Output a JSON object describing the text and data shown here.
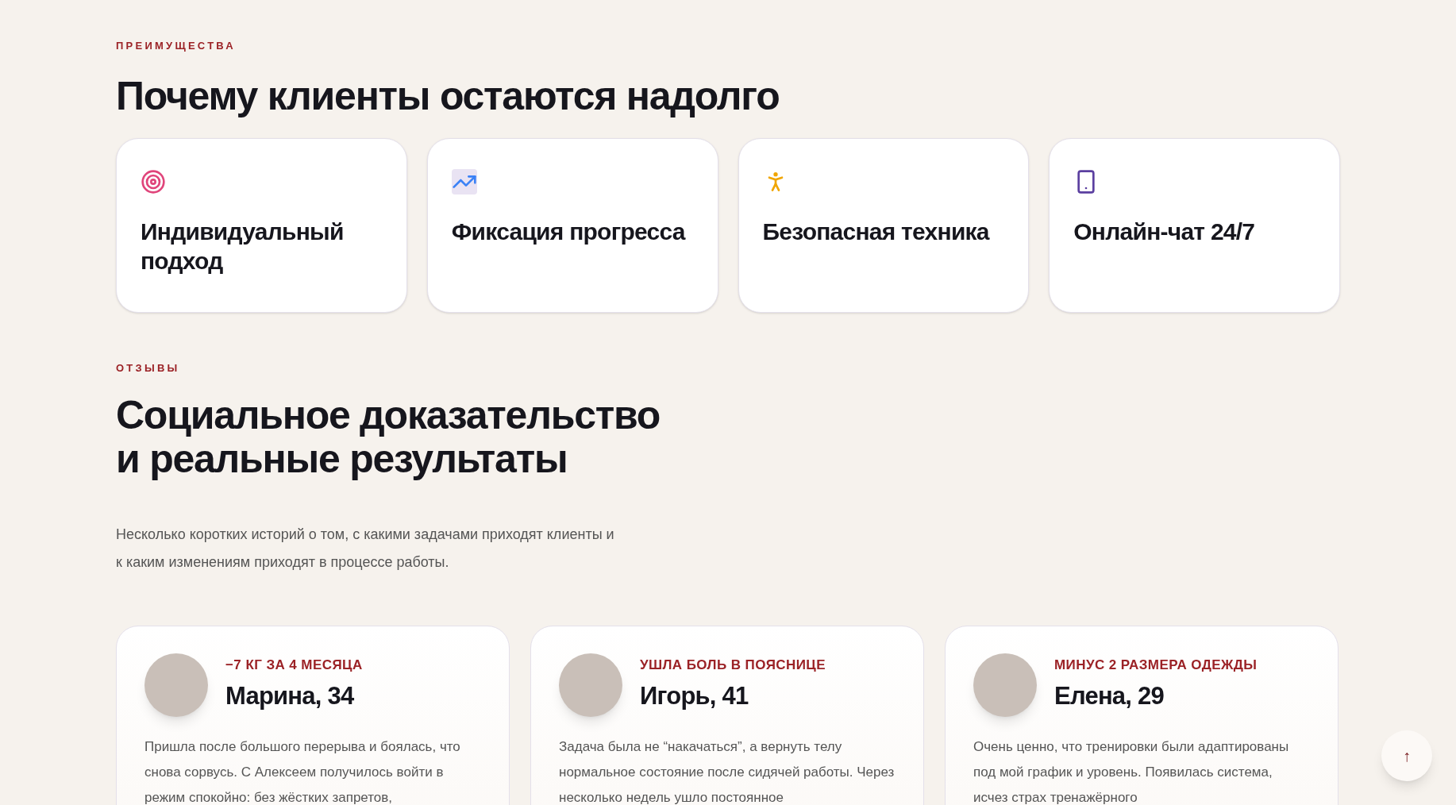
{
  "features": {
    "eyebrow": "ПРЕИМУЩЕСТВА",
    "title": "Почему клиенты остаются надолго",
    "cards": [
      {
        "kind": "target",
        "title": "Индивидуальный подход"
      },
      {
        "kind": "chart",
        "title": "Фиксация прогресса"
      },
      {
        "kind": "person",
        "title": "Безопасная техника"
      },
      {
        "kind": "phone",
        "title": "Онлайн-чат 24/7"
      }
    ]
  },
  "reviews": {
    "eyebrow": "ОТЗЫВЫ",
    "title_lines": [
      "Социальное доказательство",
      "и реальные результаты"
    ],
    "intro": "Несколько коротких историй о том, с какими задачами приходят клиенты и к каким изменениям приходят в процессе работы.",
    "items": [
      {
        "result": "−7 КГ ЗА 4 МЕСЯЦА",
        "name": "Марина, 34",
        "text": "Пришла после большого перерыва и боялась, что снова сорвусь. С Алексеем получилось войти в режим спокойно: без жёстких запретов,"
      },
      {
        "result": "УШЛА БОЛЬ В ПОЯСНИЦЕ",
        "name": "Игорь, 41",
        "text": "Задача была не “накачаться”, а вернуть телу нормальное состояние после сидячей работы. Через несколько недель ушло постоянное"
      },
      {
        "result": "МИНУС 2 РАЗМЕРА ОДЕЖДЫ",
        "name": "Елена, 29",
        "text": "Очень ценно, что тренировки были адаптированы под мой график и уровень. Появилась система, исчез страх тренажёрного"
      }
    ]
  },
  "scroll_top": {
    "label": "↑"
  }
}
